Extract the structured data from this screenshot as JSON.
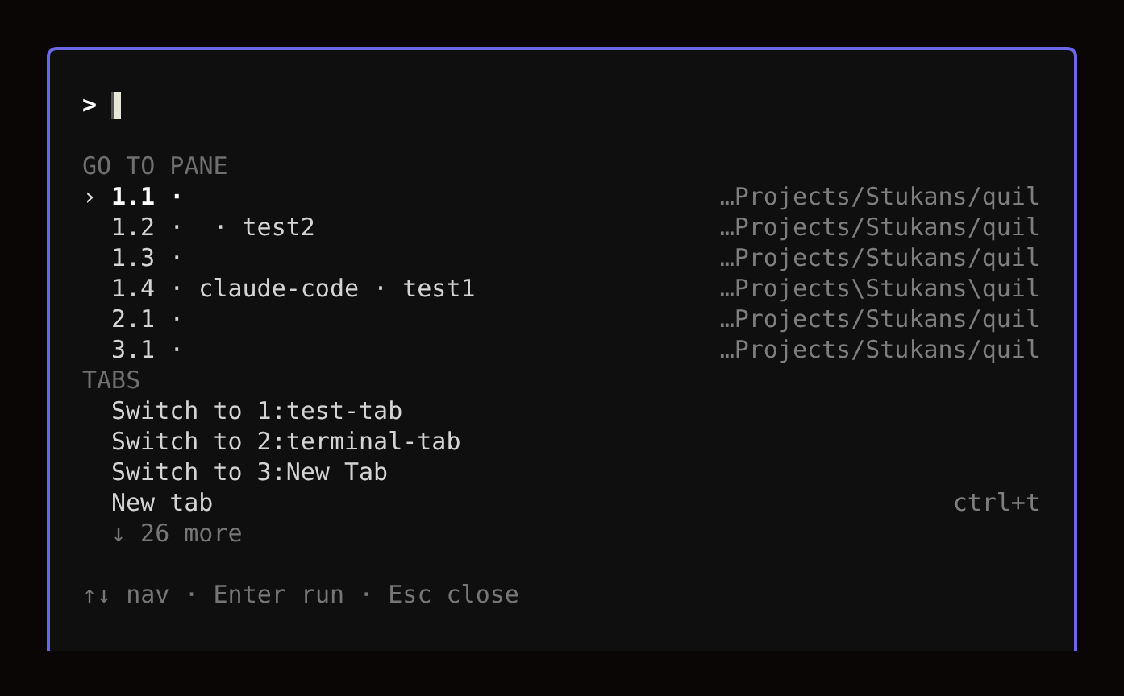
{
  "prompt": {
    "symbol": ">"
  },
  "go_to_pane": {
    "heading": "GO TO PANE",
    "selection_marker": "›",
    "items": [
      {
        "label": "1.1 ·",
        "path": "…Projects/Stukans/quil",
        "selected": true
      },
      {
        "label": "1.2 ·  · test2",
        "path": "…Projects/Stukans/quil",
        "selected": false
      },
      {
        "label": "1.3 ·",
        "path": "…Projects/Stukans/quil",
        "selected": false
      },
      {
        "label": "1.4 · claude-code · test1",
        "path": "…Projects\\Stukans\\quil",
        "selected": false
      },
      {
        "label": "2.1 ·",
        "path": "…Projects/Stukans/quil",
        "selected": false
      },
      {
        "label": "3.1 ·",
        "path": "…Projects/Stukans/quil",
        "selected": false
      }
    ]
  },
  "tabs": {
    "heading": "TABS",
    "items": [
      {
        "label": "Switch to 1:test-tab"
      },
      {
        "label": "Switch to 2:terminal-tab"
      },
      {
        "label": "Switch to 3:New Tab"
      },
      {
        "label": "New tab",
        "shortcut": "ctrl+t"
      }
    ],
    "more": "↓ 26 more"
  },
  "footer": "↑↓ nav · Enter run · Esc close"
}
